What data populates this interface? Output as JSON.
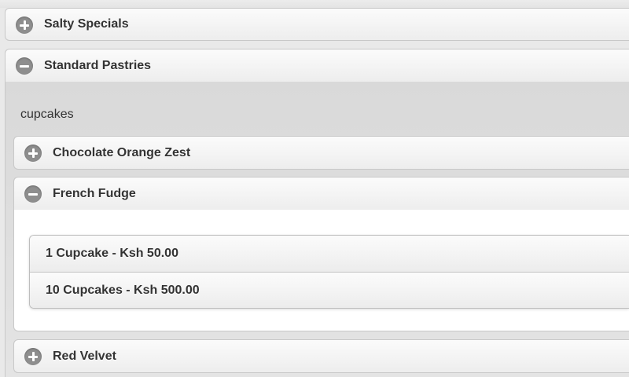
{
  "categories": [
    {
      "label": "Salty Specials",
      "state": "collapsed"
    },
    {
      "label": "Standard Pastries",
      "state": "expanded"
    }
  ],
  "standard_pastries": {
    "section_text": "cupcakes",
    "items": [
      {
        "label": "Chocolate Orange Zest",
        "state": "collapsed"
      },
      {
        "label": "French Fudge",
        "state": "expanded"
      },
      {
        "label": "Red Velvet",
        "state": "collapsed"
      }
    ]
  },
  "french_fudge_options": [
    {
      "label": "1 Cupcake - Ksh 50.00"
    },
    {
      "label": "10 Cupcakes - Ksh 500.00"
    }
  ],
  "icons": {
    "collapsed": "plus-circle-icon",
    "expanded": "minus-circle-icon"
  },
  "colors": {
    "icon": "#8e8e8e",
    "text": "#333333",
    "panel": "#dcdcdc"
  }
}
